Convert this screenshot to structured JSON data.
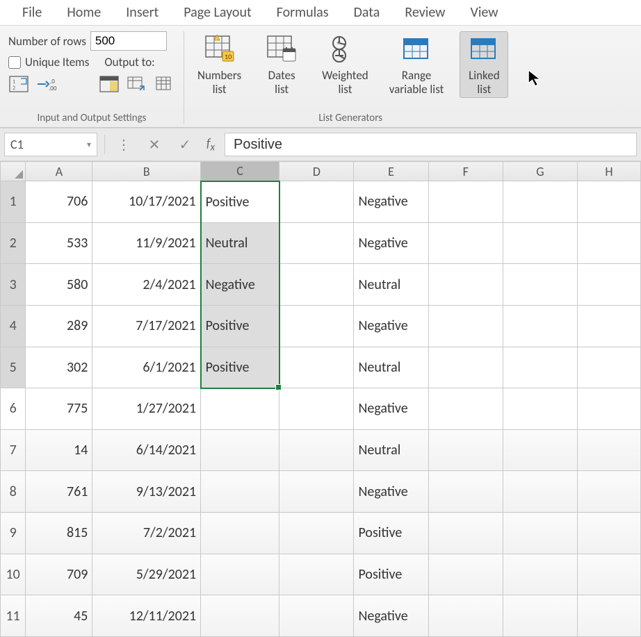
{
  "tabs": [
    "File",
    "Home",
    "Insert",
    "Page Layout",
    "Formulas",
    "Data",
    "Review",
    "View"
  ],
  "io_group": {
    "num_rows_label": "Number of rows",
    "num_rows_value": "500",
    "unique_label": "Unique Items",
    "output_label": "Output to:",
    "group_label": "Input and Output Settings"
  },
  "generators": {
    "group_label": "List Generators",
    "items": [
      {
        "id": "numbers",
        "line1": "Numbers",
        "line2": "list"
      },
      {
        "id": "dates",
        "line1": "Dates",
        "line2": "list"
      },
      {
        "id": "weighted",
        "line1": "Weighted",
        "line2": "list"
      },
      {
        "id": "range",
        "line1": "Range",
        "line2": "variable list"
      },
      {
        "id": "linked",
        "line1": "Linked",
        "line2": "list",
        "active": true
      }
    ]
  },
  "namebox": "C1",
  "formula_value": "Positive",
  "columns": [
    "A",
    "B",
    "C",
    "D",
    "E",
    "F",
    "G",
    "H"
  ],
  "rows": [
    {
      "n": 1,
      "A": "706",
      "B": "10/17/2021",
      "C": "Positive",
      "E": "Negative"
    },
    {
      "n": 2,
      "A": "533",
      "B": "11/9/2021",
      "C": "Neutral",
      "E": "Negative"
    },
    {
      "n": 3,
      "A": "580",
      "B": "2/4/2021",
      "C": "Negative",
      "E": "Neutral"
    },
    {
      "n": 4,
      "A": "289",
      "B": "7/17/2021",
      "C": "Positive",
      "E": "Negative"
    },
    {
      "n": 5,
      "A": "302",
      "B": "6/1/2021",
      "C": "Positive",
      "E": "Neutral"
    },
    {
      "n": 6,
      "A": "775",
      "B": "1/27/2021",
      "C": "",
      "E": "Negative"
    },
    {
      "n": 7,
      "A": "14",
      "B": "6/14/2021",
      "C": "",
      "E": "Neutral"
    },
    {
      "n": 8,
      "A": "761",
      "B": "9/13/2021",
      "C": "",
      "E": "Negative"
    },
    {
      "n": 9,
      "A": "815",
      "B": "7/2/2021",
      "C": "",
      "E": "Positive"
    },
    {
      "n": 10,
      "A": "709",
      "B": "5/29/2021",
      "C": "",
      "E": "Positive"
    },
    {
      "n": 11,
      "A": "45",
      "B": "12/11/2021",
      "C": "",
      "E": "Negative"
    }
  ],
  "selection": {
    "col": "C",
    "r1": 1,
    "r2": 5
  }
}
